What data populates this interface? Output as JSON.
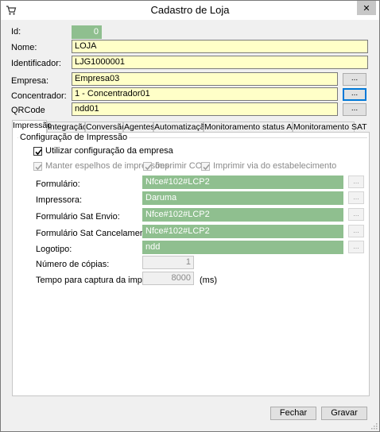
{
  "window": {
    "title": "Cadastro de Loja",
    "close_glyph": "✕"
  },
  "form": {
    "id_label": "Id:",
    "id_value": "0",
    "nome_label": "Nome:",
    "nome_value": "LOJA",
    "identificador_label": "Identificador:",
    "identificador_value": "LJG1000001",
    "empresa_label": "Empresa:",
    "empresa_value": "Empresa03",
    "concentrador_label": "Concentrador:",
    "concentrador_value": "1 - Concentrador01",
    "qrcode_label": "QRCode",
    "qrcode_value": "ndd01",
    "browse_label": "..."
  },
  "tabs": [
    {
      "label": "Impressão"
    },
    {
      "label": "Integração"
    },
    {
      "label": "Conversão"
    },
    {
      "label": "Agentes"
    },
    {
      "label": "Automatização"
    },
    {
      "label": "Monitoramento status Agente"
    },
    {
      "label": "Monitoramento SAT"
    }
  ],
  "impressao": {
    "group_title": "Configuração de Impressão",
    "utilizar_config": "Utilizar configuração da empresa",
    "manter_espelhos": "Manter espelhos de impressões",
    "imprimir_coo": "Imprimir COO",
    "imprimir_via": "Imprimir via do estabelecimento",
    "formulario_label": "Formulário:",
    "formulario_value": "Nfce#102#LCP2",
    "impressora_label": "Impressora:",
    "impressora_value": "Daruma",
    "form_sat_envio_label": "Formulário Sat Envio:",
    "form_sat_envio_value": "Nfce#102#LCP2",
    "form_sat_cancel_label": "Formulário Sat Cancelamento:",
    "form_sat_cancel_value": "Nfce#102#LCP2",
    "logotipo_label": "Logotipo:",
    "logotipo_value": "ndd",
    "copias_label": "Número de cópias:",
    "copias_value": "1",
    "tempo_label": "Tempo para captura da impressão:",
    "tempo_value": "8000",
    "tempo_unit": "(ms)",
    "browse_label": "..."
  },
  "footer": {
    "fechar": "Fechar",
    "gravar": "Gravar"
  }
}
